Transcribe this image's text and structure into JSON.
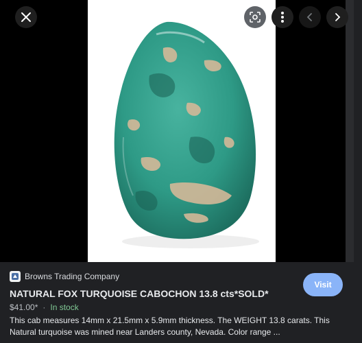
{
  "toolbar": {
    "close_icon": "close-icon",
    "lens_icon": "lens-scan-icon",
    "more_icon": "more-vertical-icon",
    "prev_icon": "chevron-left-icon",
    "next_icon": "chevron-right-icon"
  },
  "image": {
    "subject": "turquoise-cabochon-photo",
    "stone_color": "#2e9a86",
    "matrix_color": "#d4b998"
  },
  "result": {
    "source_name": "Browns Trading Company",
    "title": "NATURAL FOX TURQUOISE CABOCHON 13.8 cts*SOLD*",
    "price": "$41.00*",
    "separator": "·",
    "stock": "In stock",
    "description": "This cab measures 14mm x 21.5mm x 5.9mm thickness. The WEIGHT 13.8 carats. This Natural turquoise was mined near Landers county, Nevada. Color range ...",
    "visit_label": "Visit"
  },
  "colors": {
    "accent": "#8ab4f8",
    "in_stock": "#81c995",
    "background": "#202124"
  }
}
